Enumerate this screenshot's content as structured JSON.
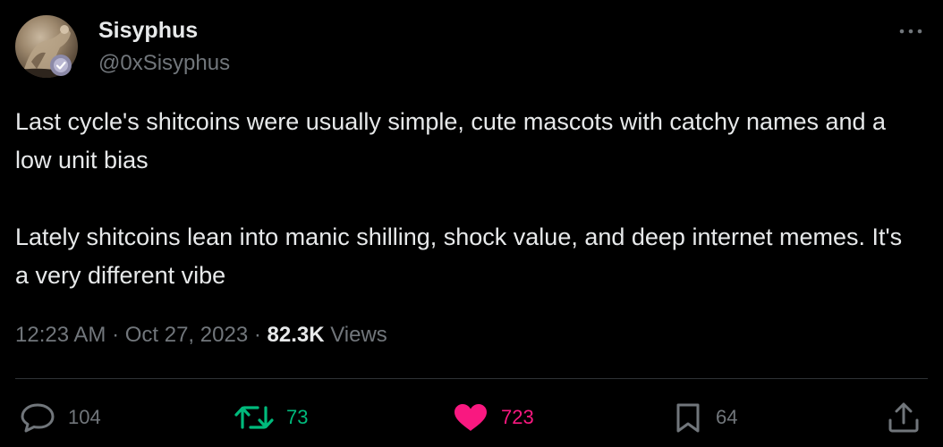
{
  "author": {
    "display_name": "Sisyphus",
    "handle": "@0xSisyphus",
    "verified": true
  },
  "tweet": {
    "paragraphs": [
      "Last cycle's shitcoins were usually simple, cute mascots with catchy names and a low unit bias",
      "Lately shitcoins lean into manic shilling, shock value, and deep internet memes. It's a very different vibe"
    ]
  },
  "meta": {
    "time": "12:23 AM",
    "separator": " · ",
    "date": "Oct 27, 2023",
    "views_count": "82.3K",
    "views_label": " Views"
  },
  "actions": {
    "replies": "104",
    "retweets": "73",
    "likes": "723",
    "bookmarks": "64"
  },
  "colors": {
    "background": "#000000",
    "text": "#e7e9ea",
    "secondary": "#71767b",
    "retweet": "#00ba7c",
    "like": "#f91880",
    "divider": "#2f3336"
  },
  "icons": [
    "more-icon",
    "reply-icon",
    "retweet-icon",
    "like-icon",
    "bookmark-icon",
    "share-icon",
    "verified-icon"
  ]
}
